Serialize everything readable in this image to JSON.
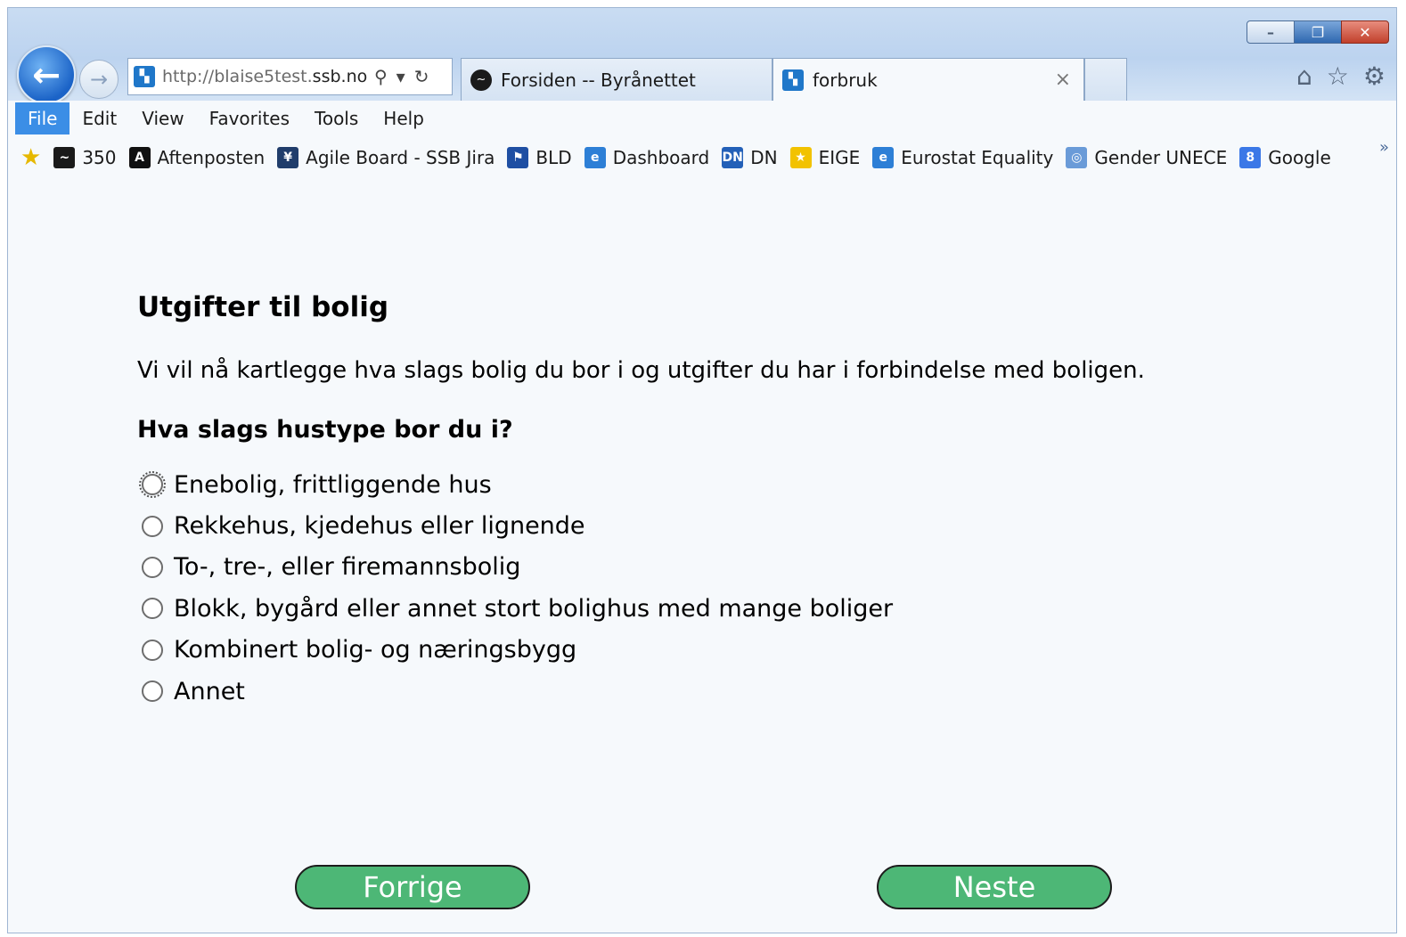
{
  "window": {
    "controls": {
      "minimize": "–",
      "maximize": "❐",
      "close": "✕"
    }
  },
  "nav": {
    "back_icon": "back-arrow-icon",
    "forward_icon": "forward-arrow-icon"
  },
  "address": {
    "url_prefix": "http://blaise5test.",
    "url_domain": "ssb.no",
    "url_suffix": "/",
    "search_glyph": "⚲",
    "dropdown_glyph": "▾",
    "refresh_glyph": "↻"
  },
  "tabs": [
    {
      "label": "Forsiden -- Byrånettet",
      "icon": "byranettet-icon"
    },
    {
      "label": "forbruk",
      "icon": "ssb-icon",
      "close": "×"
    }
  ],
  "menu": [
    "File",
    "Edit",
    "View",
    "Favorites",
    "Tools",
    "Help"
  ],
  "favorites": [
    {
      "label": "350",
      "icon": "350-icon",
      "color": "#1a1a1a",
      "glyph": "~"
    },
    {
      "label": "Aftenposten",
      "icon": "aftenposten-icon",
      "color": "#111111",
      "glyph": "A"
    },
    {
      "label": "Agile Board - SSB Jira",
      "icon": "jira-icon",
      "color": "#203d6b",
      "glyph": "¥"
    },
    {
      "label": "BLD",
      "icon": "bld-icon",
      "color": "#1f4fa3",
      "glyph": "⚑"
    },
    {
      "label": "Dashboard",
      "icon": "ie-page-icon",
      "color": "#2d7fd6",
      "glyph": "e"
    },
    {
      "label": "DN",
      "icon": "dn-icon",
      "color": "#2360b8",
      "glyph": "DN"
    },
    {
      "label": "EIGE",
      "icon": "eige-icon",
      "color": "#f2c200",
      "glyph": "★"
    },
    {
      "label": "Eurostat Equality",
      "icon": "ie-page-icon",
      "color": "#2d7fd6",
      "glyph": "e"
    },
    {
      "label": "Gender UNECE",
      "icon": "un-icon",
      "color": "#6a9bd8",
      "glyph": "◎"
    },
    {
      "label": "Google",
      "icon": "google-icon",
      "color": "#3b78e7",
      "glyph": "8"
    }
  ],
  "favbar_more": "»",
  "page": {
    "heading": "Utgifter til bolig",
    "intro": "Vi vil nå kartlegge hva slags bolig du bor i og utgifter du har i forbindelse med boligen.",
    "question": "Hva slags hustype bor du i?",
    "options": [
      "Enebolig, frittliggende hus",
      "Rekkehus, kjedehus eller lignende",
      "To-, tre-, eller firemannsbolig",
      "Blokk, bygård eller annet stort bolighus med mange boliger",
      "Kombinert bolig- og næringsbygg",
      "Annet"
    ],
    "prev_button": "Forrige",
    "next_button": "Neste"
  }
}
